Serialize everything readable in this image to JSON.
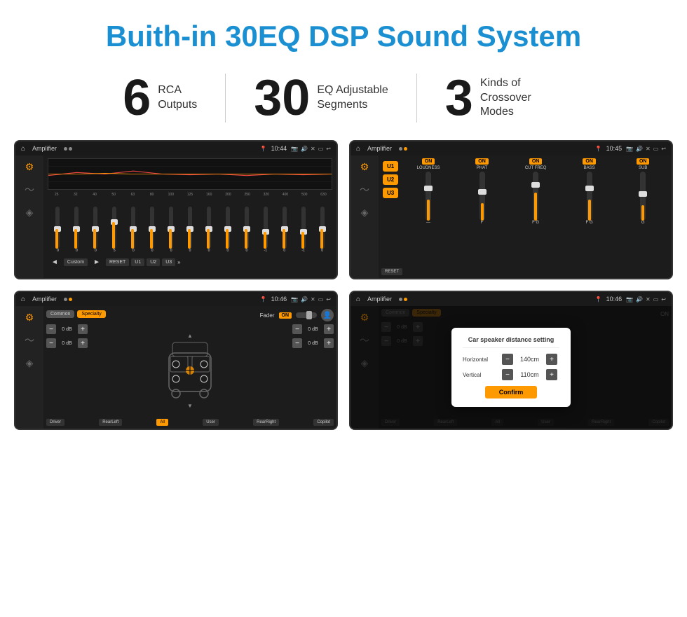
{
  "page": {
    "title": "Buith-in 30EQ DSP Sound System",
    "stats": [
      {
        "number": "6",
        "line1": "RCA",
        "line2": "Outputs"
      },
      {
        "number": "30",
        "line1": "EQ Adjustable",
        "line2": "Segments"
      },
      {
        "number": "3",
        "line1": "Kinds of",
        "line2": "Crossover Modes"
      }
    ]
  },
  "screens": {
    "eq": {
      "title": "Amplifier",
      "time": "10:44",
      "freqs": [
        "25",
        "32",
        "40",
        "50",
        "63",
        "80",
        "100",
        "125",
        "160",
        "200",
        "250",
        "320",
        "400",
        "500",
        "630"
      ],
      "values": [
        "0",
        "0",
        "0",
        "5",
        "0",
        "0",
        "0",
        "0",
        "0",
        "0",
        "0",
        "-1",
        "0",
        "-1"
      ],
      "buttons": [
        "Custom",
        "RESET",
        "U1",
        "U2",
        "U3"
      ]
    },
    "crossover": {
      "title": "Amplifier",
      "time": "10:45",
      "u_buttons": [
        "U1",
        "U2",
        "U3"
      ],
      "controls": [
        {
          "label": "LOUDNESS",
          "on": true
        },
        {
          "label": "PHAT",
          "on": true
        },
        {
          "label": "CUT FREQ",
          "on": true
        },
        {
          "label": "BASS",
          "on": true
        },
        {
          "label": "SUB",
          "on": true
        }
      ],
      "reset": "RESET"
    },
    "fader": {
      "title": "Amplifier",
      "time": "10:46",
      "tabs": [
        "Common",
        "Specialty"
      ],
      "active_tab": "Specialty",
      "fader_label": "Fader",
      "fader_on": "ON",
      "vol_rows": [
        {
          "val": "0 dB"
        },
        {
          "val": "0 dB"
        },
        {
          "val": "0 dB"
        },
        {
          "val": "0 dB"
        }
      ],
      "bottom_buttons": [
        "Driver",
        "RearLeft",
        "All",
        "User",
        "RearRight",
        "Copilot"
      ]
    },
    "dialog": {
      "title": "Amplifier",
      "time": "10:46",
      "tabs": [
        "Common",
        "Specialty"
      ],
      "dialog_title": "Car speaker distance setting",
      "horizontal_label": "Horizontal",
      "horizontal_val": "140cm",
      "vertical_label": "Vertical",
      "vertical_val": "110cm",
      "confirm_btn": "Confirm",
      "vol_rows": [
        {
          "val": "0 dB"
        },
        {
          "val": "0 dB"
        }
      ],
      "bottom_buttons": [
        "Driver",
        "RearLeft",
        "All",
        "User",
        "RearRight",
        "Copilot"
      ]
    }
  }
}
